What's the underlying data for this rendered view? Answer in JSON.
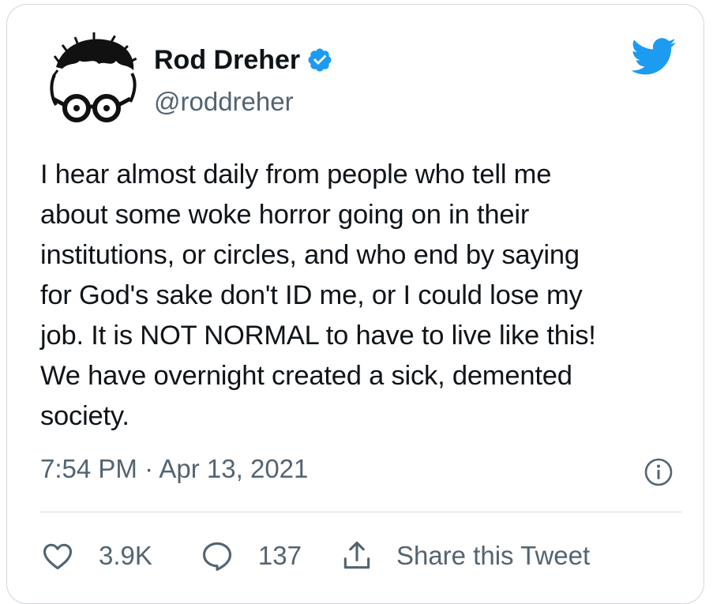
{
  "author": {
    "display_name": "Rod Dreher",
    "handle": "@roddreher",
    "verified": true,
    "avatar": "avatar-illustration-with-round-glasses"
  },
  "tweet": {
    "text": "I hear almost daily from people who tell me\nabout some woke horror going on in their\ninstitutions, or circles, and who end by saying\nfor God's sake don't ID me, or I could lose my\njob. It is NOT NORMAL to have to live like this!\nWe have overnight created a sick, demented\nsociety.",
    "timestamp": "7:54 PM · Apr 13, 2021"
  },
  "actions": {
    "like_count": "3.9K",
    "reply_count": "137",
    "share_label": "Share this Tweet"
  },
  "icons": {
    "brand": "twitter-bird-icon",
    "verified": "verified-badge-icon",
    "info": "info-icon",
    "like": "heart-icon",
    "reply": "reply-bubble-icon",
    "share": "share-upload-icon"
  },
  "colors": {
    "brand_blue": "#1d9bf0",
    "secondary_text": "#536471",
    "primary_text": "#0f1419",
    "border": "#cfd9de"
  }
}
